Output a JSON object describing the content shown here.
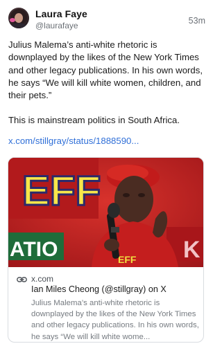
{
  "author": {
    "name": "Laura Faye",
    "handle": "@laurafaye",
    "time": "53m"
  },
  "post": {
    "paragraphs": [
      "Julius Malema’s anti-white rhetoric is downplayed by the likes of the New York Times and other legacy publications. In his own words, he says “We will kill white women, children, and their pets.”",
      "This is mainstream politics in South Africa."
    ],
    "link_text": "x.com/stillgray/status/1888590..."
  },
  "link_card": {
    "image_text": {
      "banner_letters": "EFF",
      "lower_banner": "ATIO",
      "lower_banner_right": "K",
      "shirt_text": "EFF"
    },
    "domain": "x.com",
    "title": "Ian Miles Cheong (@stillgray) on X",
    "description": "Julius Malema’s anti-white rhetoric  is downplayed by the likes of the New York Times and other legacy publications. In his own words, he says “We will kill white wome..."
  },
  "colors": {
    "link": "#2f6fd8",
    "secondary_text": "#6b7076",
    "card_border": "#d8dce0",
    "eff_red": "#c8221f"
  },
  "icons": {
    "avatar": "profile-photo",
    "card_link": "chain-link-icon"
  }
}
